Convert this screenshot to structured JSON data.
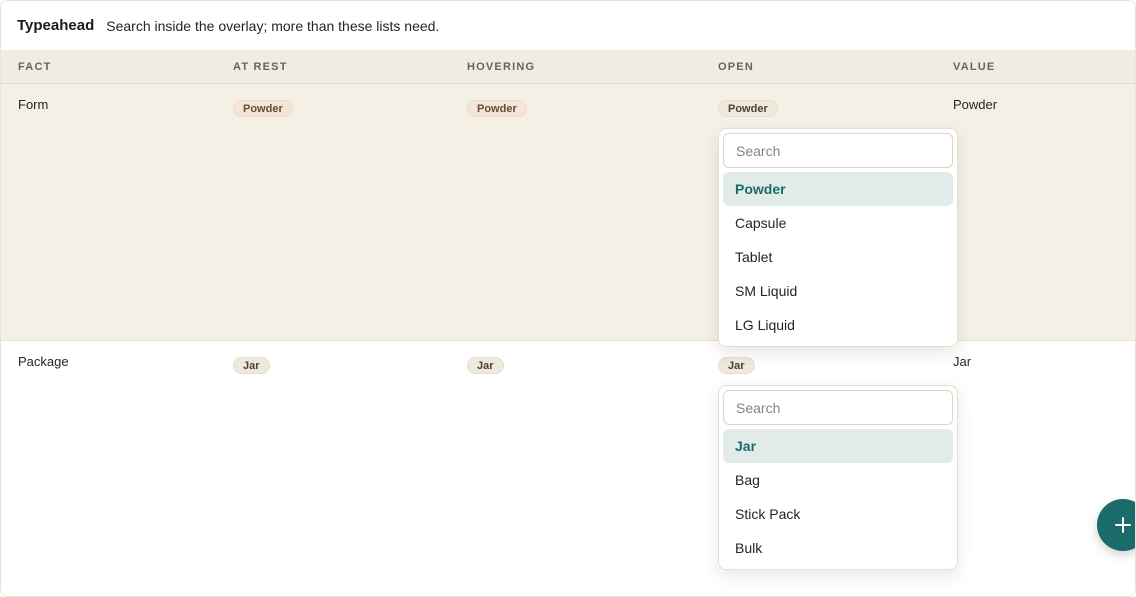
{
  "header": {
    "title": "Typeahead",
    "subtitle": "Search inside the overlay; more than these lists need."
  },
  "columns": [
    "FACT",
    "AT REST",
    "HOVERING",
    "OPEN",
    "VALUE"
  ],
  "rows": [
    {
      "fact": "Form",
      "at_rest": "Powder",
      "hovering": "Powder",
      "open": "Powder",
      "value": "Powder",
      "dropdown": {
        "placeholder": "Search",
        "options": [
          "Powder",
          "Capsule",
          "Tablet",
          "SM Liquid",
          "LG Liquid"
        ],
        "selected_index": 0
      }
    },
    {
      "fact": "Package",
      "at_rest": "Jar",
      "hovering": "Jar",
      "open": "Jar",
      "value": "Jar",
      "dropdown": {
        "placeholder": "Search",
        "options": [
          "Jar",
          "Bag",
          "Stick Pack",
          "Bulk"
        ],
        "selected_index": 0
      }
    }
  ],
  "fab": {
    "icon": "plus-icon"
  },
  "colors": {
    "accent": "#1b6b6a",
    "selected_bg": "#e1ece8",
    "row_highlight": "#f5f0e6",
    "header_bg": "#f1ece2"
  }
}
